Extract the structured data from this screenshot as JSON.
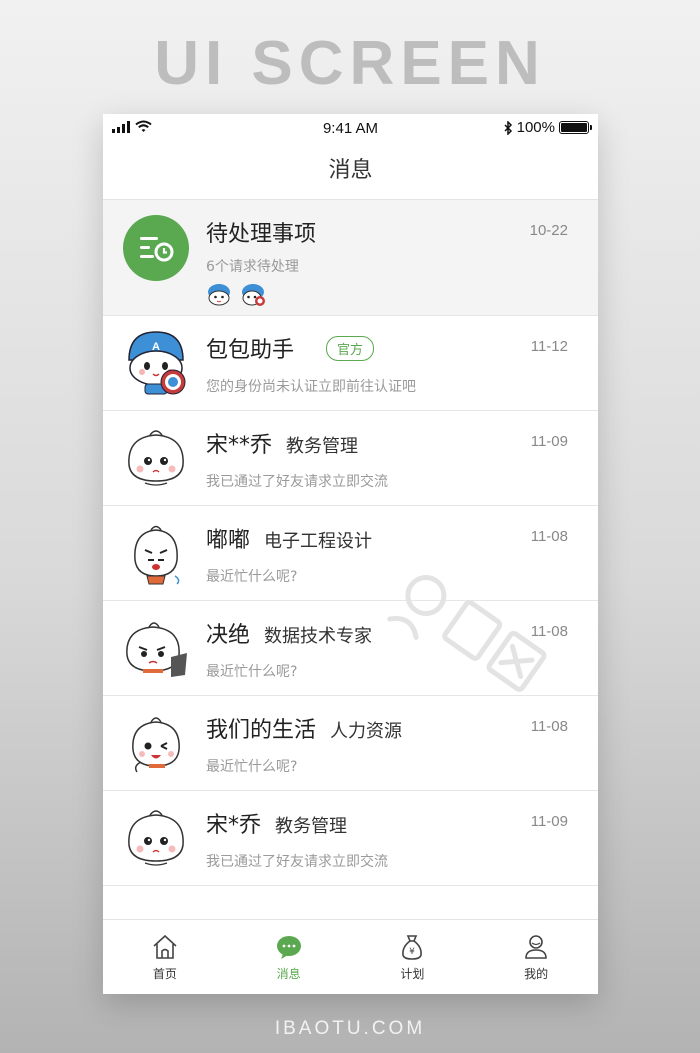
{
  "banner": "UI SCREEN",
  "footer_brand": "IBAOTU.COM",
  "status_bar": {
    "time": "9:41 AM",
    "battery": "100%",
    "battery_level": 1.0
  },
  "nav": {
    "title": "消息"
  },
  "colors": {
    "accent": "#5aa84f",
    "pending_bg": "#f4f4f4",
    "muted_text": "#9a9a9a"
  },
  "messages": [
    {
      "name": "待处理事项",
      "dept": "",
      "badge": "",
      "desc": "6个请求待处理",
      "date": "10-22",
      "avatar": "clock-list-icon"
    },
    {
      "name": "包包助手",
      "dept": "",
      "badge": "官方",
      "desc": "您的身份尚未认证立即前往认证吧",
      "date": "11-12",
      "avatar": "captain-bun-avatar"
    },
    {
      "name": "宋**乔",
      "dept": "教务管理",
      "badge": "",
      "desc": "我已通过了好友请求立即交流",
      "date": "11-09",
      "avatar": "bun-avatar"
    },
    {
      "name": "嘟嘟",
      "dept": "电子工程设计",
      "badge": "",
      "desc": "最近忙什么呢?",
      "date": "11-08",
      "avatar": "bun-avatar"
    },
    {
      "name": "决绝",
      "dept": "数据技术专家",
      "badge": "",
      "desc": "最近忙什么呢?",
      "date": "11-08",
      "avatar": "bun-avatar"
    },
    {
      "name": "我们的生活",
      "dept": "人力资源",
      "badge": "",
      "desc": "最近忙什么呢?",
      "date": "11-08",
      "avatar": "bun-avatar"
    },
    {
      "name": "宋*乔",
      "dept": "教务管理",
      "badge": "",
      "desc": "我已通过了好友请求立即交流",
      "date": "11-09",
      "avatar": "bun-avatar"
    }
  ],
  "tabs": [
    {
      "label": "首页",
      "icon": "home-icon",
      "active": false
    },
    {
      "label": "消息",
      "icon": "chat-bubble-icon",
      "active": true
    },
    {
      "label": "计划",
      "icon": "money-bag-icon",
      "active": false
    },
    {
      "label": "我的",
      "icon": "user-icon",
      "active": false
    }
  ]
}
